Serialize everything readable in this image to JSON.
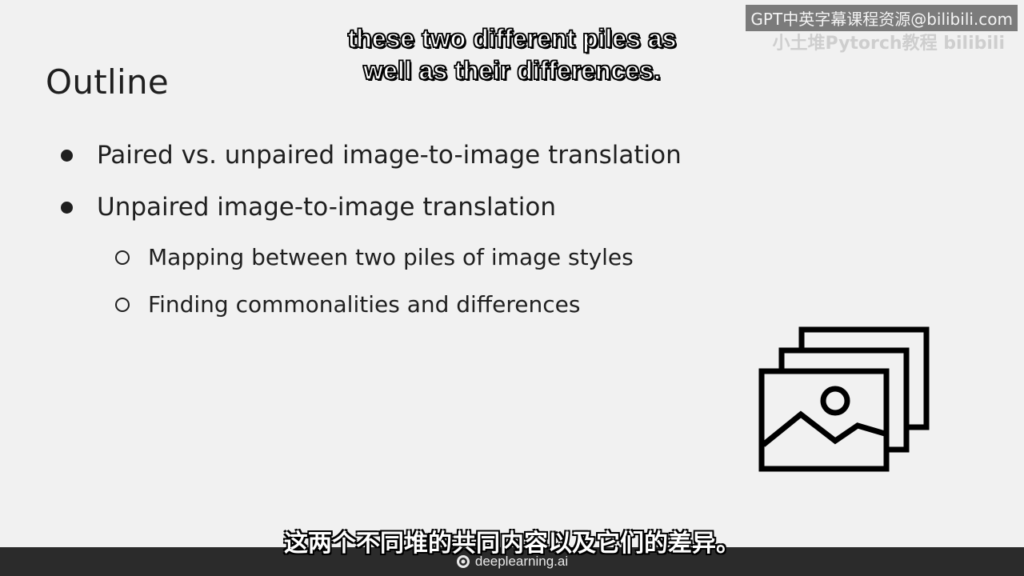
{
  "slide": {
    "title": "Outline",
    "bullets": [
      "Paired vs. unpaired image-to-image translation",
      "Unpaired image-to-image translation"
    ],
    "sub_bullets": [
      "Mapping between two piles of image styles",
      "Finding commonalities and differences"
    ],
    "icon": "image-stack-icon"
  },
  "subtitles": {
    "english_line1": "these two different piles as",
    "english_line2": "well as their differences.",
    "chinese": "这两个不同堆的共同内容以及它们的差异。"
  },
  "watermark": {
    "text": "GPT中英字幕课程资源@bilibili.com",
    "faint_text": "小土堆Pytorch教程 bilibili"
  },
  "footer": {
    "brand": "deeplearning.ai",
    "bar_color": "#2b2b2b"
  },
  "colors": {
    "background": "#f1f1f1",
    "text": "#1f1f1f"
  }
}
